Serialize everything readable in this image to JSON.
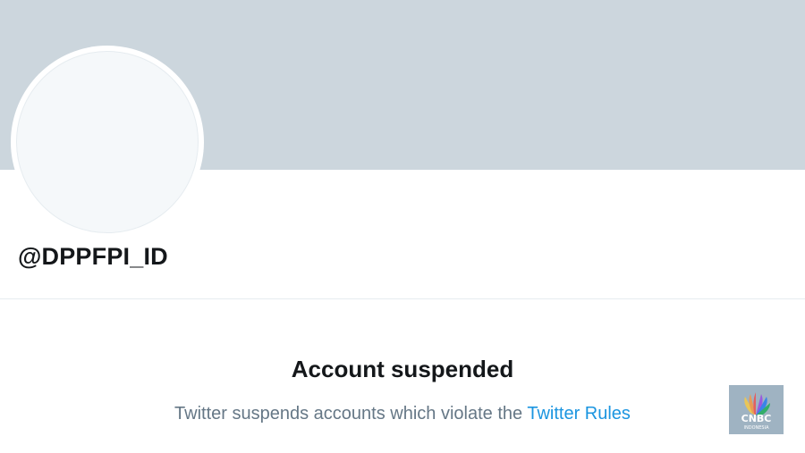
{
  "profile": {
    "handle": "@DPPFPI_ID"
  },
  "suspension": {
    "title": "Account suspended",
    "message_prefix": "Twitter suspends accounts which violate the ",
    "link_label": "Twitter Rules"
  },
  "watermark": {
    "brand": "CNBC",
    "subtitle": "INDONESIA"
  },
  "colors": {
    "banner": "#ccd6dd",
    "link": "#1b95e0",
    "text_primary": "#14171a",
    "text_secondary": "#657786"
  }
}
